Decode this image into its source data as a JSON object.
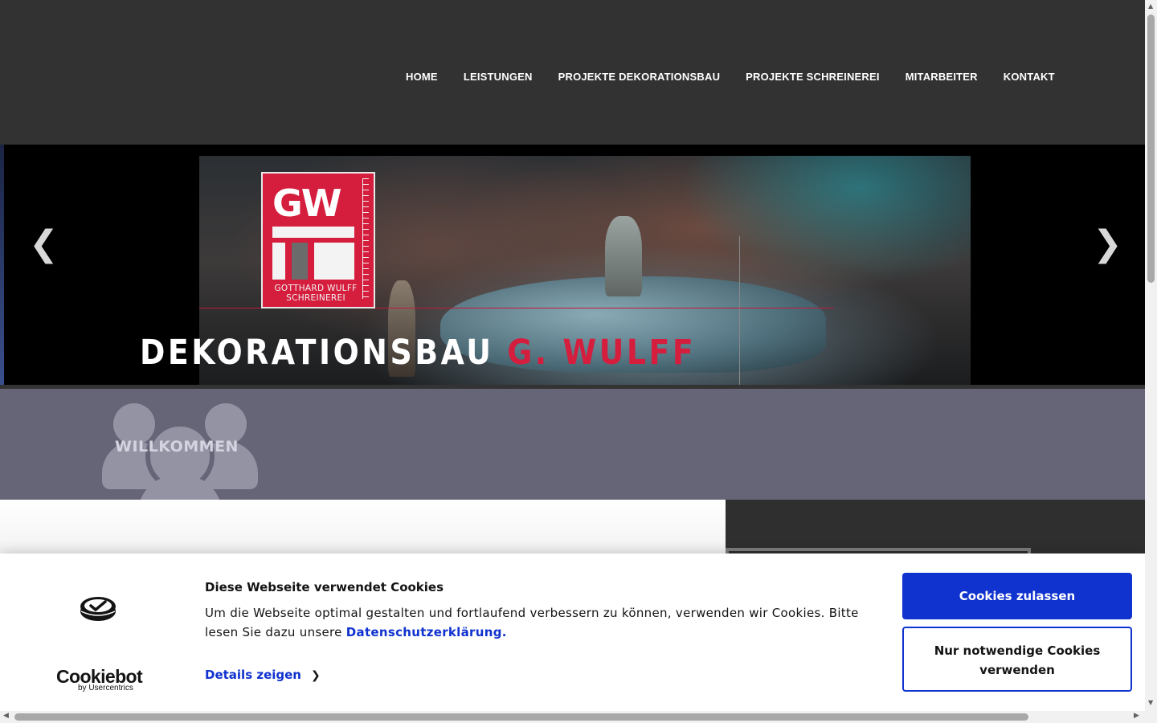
{
  "nav": {
    "items": [
      {
        "label": "HOME"
      },
      {
        "label": "LEISTUNGEN"
      },
      {
        "label": "PROJEKTE DEKORATIONSBAU"
      },
      {
        "label": "PROJEKTE SCHREINEREI"
      },
      {
        "label": "MITARBEITER"
      },
      {
        "label": "KONTAKT"
      }
    ]
  },
  "slider": {
    "logo_initials": "GW",
    "logo_line1": "GOTTHARD WULFF",
    "logo_line2": "SCHREINEREI",
    "title_main": "DEKORATIONSBAU ",
    "title_accent": "G. WULFF",
    "prev_arrow": "❮",
    "next_arrow": "❯"
  },
  "welcome": {
    "label": "WILLKOMMEN",
    "icon": "people-group-icon"
  },
  "cookie_banner": {
    "brand": "Cookiebot",
    "brand_sub": "by Usercentrics",
    "heading": "Diese Webseite verwendet Cookies",
    "text": "Um die Webseite optimal gestalten und fortlaufend verbessern zu können, verwenden wir Cookies. Bitte lesen Sie dazu unsere ",
    "privacy_link": "Datenschutzerklärung.",
    "details_label": "Details zeigen",
    "allow_label": "Cookies zulassen",
    "necessary_label": "Nur notwendige Cookies verwenden"
  },
  "colors": {
    "header_bg": "#323232",
    "accent_red": "#d51d3d",
    "welcome_bg": "#666578",
    "cookie_blue": "#1032cf"
  }
}
